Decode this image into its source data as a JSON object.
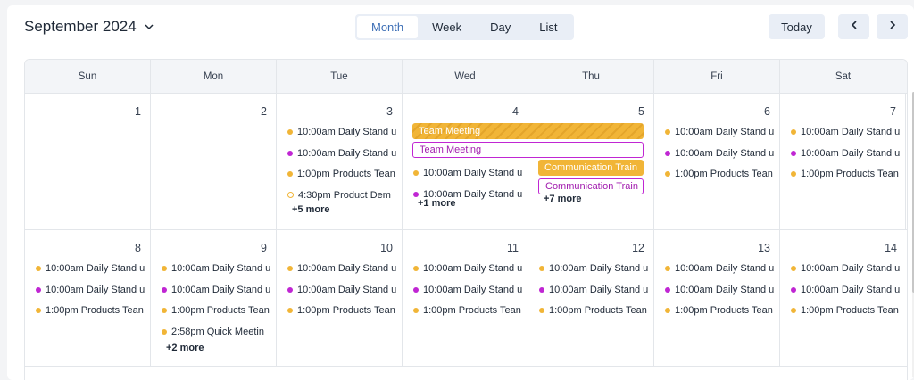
{
  "header": {
    "month_title": "September 2024",
    "views": [
      "Month",
      "Week",
      "Day",
      "List"
    ],
    "active_view": "Month",
    "today_label": "Today",
    "prev_icon": "chevron-left-icon",
    "next_icon": "chevron-right-icon"
  },
  "colors": {
    "accent_blue": "#3d6fb6",
    "event_yellow": "#f1b537",
    "event_magenta": "#c026d3"
  },
  "weekdays": [
    "Sun",
    "Mon",
    "Tue",
    "Wed",
    "Thu",
    "Fri",
    "Sat"
  ],
  "weeks": [
    {
      "days": [
        {
          "num": "1",
          "events": [],
          "more": ""
        },
        {
          "num": "2",
          "events": [],
          "more": ""
        },
        {
          "num": "3",
          "events": [
            {
              "text": "10:00am Daily Stand u",
              "color": "yellow"
            },
            {
              "text": "10:00am Daily Stand u",
              "color": "magenta"
            },
            {
              "text": "1:00pm Products Tean",
              "color": "yellow"
            },
            {
              "text": "4:30pm Product Dem",
              "color": "yellow-ring"
            }
          ],
          "more": "+5 more"
        },
        {
          "num": "4",
          "events": [
            {
              "text": "10:00am Daily Stand u",
              "color": "yellow"
            },
            {
              "text": "10:00am Daily Stand u",
              "color": "magenta"
            }
          ],
          "more": "+1 more"
        },
        {
          "num": "5",
          "events": [],
          "more": "+7 more"
        },
        {
          "num": "6",
          "events": [
            {
              "text": "10:00am Daily Stand u",
              "color": "yellow"
            },
            {
              "text": "10:00am Daily Stand u",
              "color": "magenta"
            },
            {
              "text": "1:00pm Products Tean",
              "color": "yellow"
            }
          ],
          "more": ""
        },
        {
          "num": "7",
          "events": [
            {
              "text": "10:00am Daily Stand u",
              "color": "yellow"
            },
            {
              "text": "10:00am Daily Stand u",
              "color": "magenta"
            },
            {
              "text": "1:00pm Products Tean",
              "color": "yellow"
            }
          ],
          "more": ""
        }
      ],
      "bars": [
        {
          "label": "Team Meeting",
          "style": "striped"
        },
        {
          "label": "Team Meeting",
          "style": "outline"
        },
        {
          "label": "Communication Train",
          "style": "solid"
        },
        {
          "label": "Communication Train",
          "style": "outline"
        }
      ]
    },
    {
      "days": [
        {
          "num": "8",
          "events": [
            {
              "text": "10:00am Daily Stand u",
              "color": "yellow"
            },
            {
              "text": "10:00am Daily Stand u",
              "color": "magenta"
            },
            {
              "text": "1:00pm Products Tean",
              "color": "yellow"
            }
          ],
          "more": ""
        },
        {
          "num": "9",
          "events": [
            {
              "text": "10:00am Daily Stand u",
              "color": "yellow"
            },
            {
              "text": "10:00am Daily Stand u",
              "color": "magenta"
            },
            {
              "text": "1:00pm Products Tean",
              "color": "yellow"
            },
            {
              "text": "2:58pm Quick Meetin",
              "color": "yellow"
            }
          ],
          "more": "+2 more"
        },
        {
          "num": "10",
          "events": [
            {
              "text": "10:00am Daily Stand u",
              "color": "yellow"
            },
            {
              "text": "10:00am Daily Stand u",
              "color": "magenta"
            },
            {
              "text": "1:00pm Products Tean",
              "color": "yellow"
            }
          ],
          "more": ""
        },
        {
          "num": "11",
          "events": [
            {
              "text": "10:00am Daily Stand u",
              "color": "yellow"
            },
            {
              "text": "10:00am Daily Stand u",
              "color": "magenta"
            },
            {
              "text": "1:00pm Products Tean",
              "color": "yellow"
            }
          ],
          "more": ""
        },
        {
          "num": "12",
          "events": [
            {
              "text": "10:00am Daily Stand u",
              "color": "yellow"
            },
            {
              "text": "10:00am Daily Stand u",
              "color": "magenta"
            },
            {
              "text": "1:00pm Products Tean",
              "color": "yellow"
            }
          ],
          "more": ""
        },
        {
          "num": "13",
          "events": [
            {
              "text": "10:00am Daily Stand u",
              "color": "yellow"
            },
            {
              "text": "10:00am Daily Stand u",
              "color": "magenta"
            },
            {
              "text": "1:00pm Products Tean",
              "color": "yellow"
            }
          ],
          "more": ""
        },
        {
          "num": "14",
          "events": [
            {
              "text": "10:00am Daily Stand u",
              "color": "yellow"
            },
            {
              "text": "10:00am Daily Stand u",
              "color": "magenta"
            },
            {
              "text": "1:00pm Products Tean",
              "color": "yellow"
            }
          ],
          "more": ""
        }
      ]
    }
  ]
}
